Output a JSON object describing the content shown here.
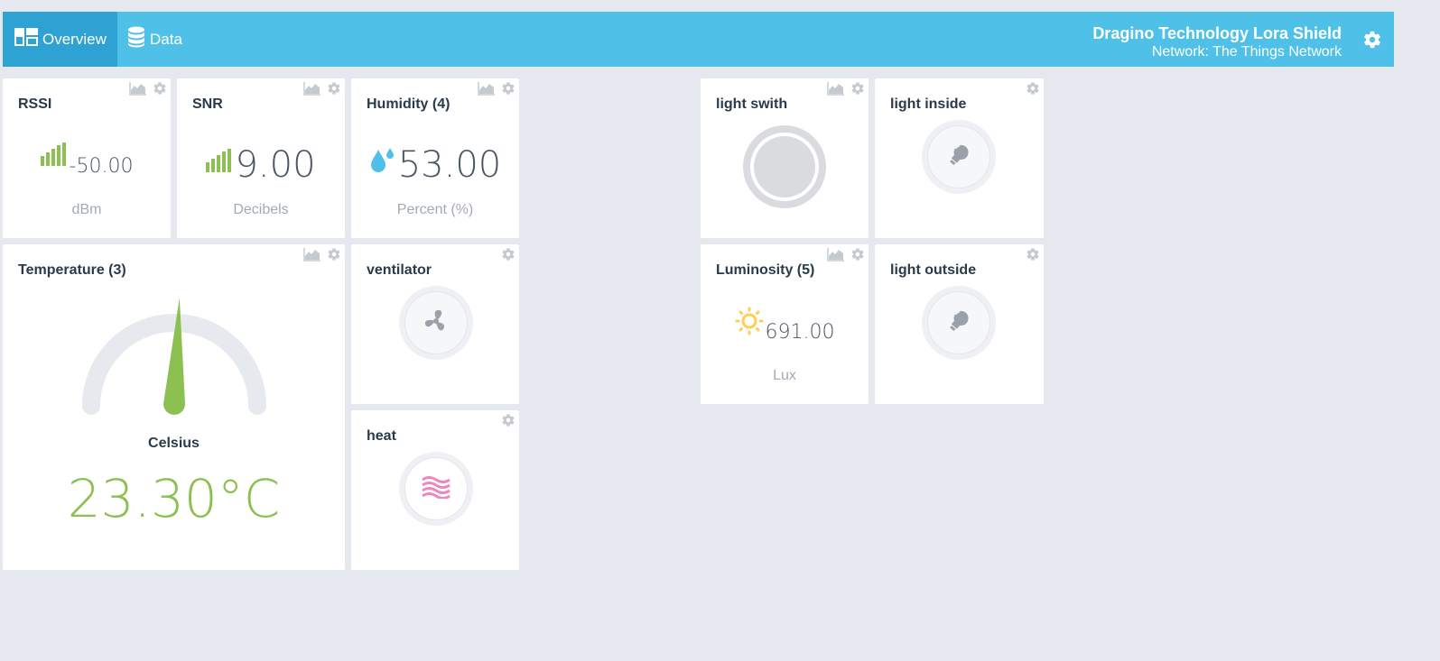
{
  "header": {
    "tabs": [
      {
        "label": "Overview",
        "active": true,
        "icon": "dashboard-icon"
      },
      {
        "label": "Data",
        "active": false,
        "icon": "database-icon"
      }
    ],
    "device_name": "Dragino Technology Lora Shield",
    "network": "Network: The Things Network"
  },
  "widgets": {
    "rssi": {
      "title": "RSSI",
      "value": "-50.00",
      "unit": "dBm"
    },
    "snr": {
      "title": "SNR",
      "value": "9.00",
      "unit": "Decibels"
    },
    "humidity": {
      "title": "Humidity (4)",
      "value": "53.00",
      "unit": "Percent (%)"
    },
    "light_switch": {
      "title": "light swith",
      "state": "off"
    },
    "light_inside": {
      "title": "light inside"
    },
    "temperature": {
      "title": "Temperature (3)",
      "label": "Celsius",
      "value": "23.30°C",
      "gauge_level": 0.53
    },
    "ventilator": {
      "title": "ventilator"
    },
    "heat": {
      "title": "heat"
    },
    "luminosity": {
      "title": "Luminosity (5)",
      "value": "691.00",
      "unit": "Lux"
    },
    "light_outside": {
      "title": "light outside"
    }
  },
  "colors": {
    "accent": "#4fc0e8",
    "active_tab": "#2ea2d3",
    "signal_green": "#8cc152",
    "humidity_blue": "#4fc0e8",
    "sun_yellow": "#ffce54",
    "heat_pink": "#ec87c0",
    "background": "#e5e8ee"
  }
}
